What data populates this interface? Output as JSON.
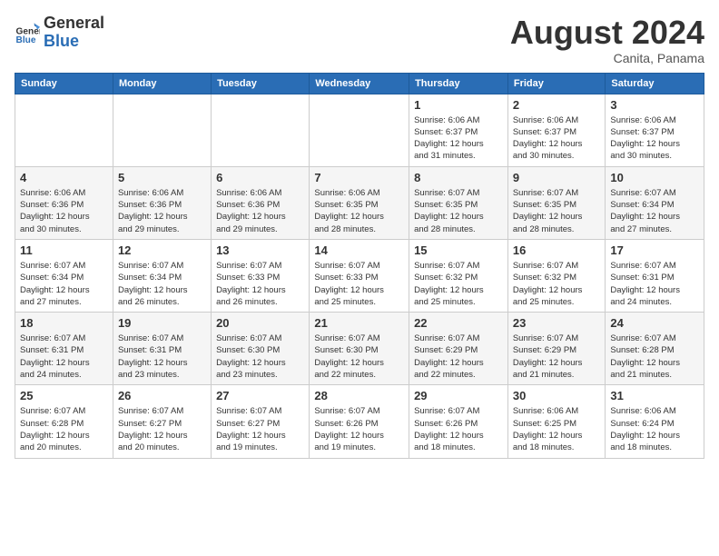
{
  "header": {
    "logo_line1": "General",
    "logo_line2": "Blue",
    "month_year": "August 2024",
    "location": "Canita, Panama"
  },
  "weekdays": [
    "Sunday",
    "Monday",
    "Tuesday",
    "Wednesday",
    "Thursday",
    "Friday",
    "Saturday"
  ],
  "weeks": [
    [
      {
        "day": "",
        "info": ""
      },
      {
        "day": "",
        "info": ""
      },
      {
        "day": "",
        "info": ""
      },
      {
        "day": "",
        "info": ""
      },
      {
        "day": "1",
        "info": "Sunrise: 6:06 AM\nSunset: 6:37 PM\nDaylight: 12 hours\nand 31 minutes."
      },
      {
        "day": "2",
        "info": "Sunrise: 6:06 AM\nSunset: 6:37 PM\nDaylight: 12 hours\nand 30 minutes."
      },
      {
        "day": "3",
        "info": "Sunrise: 6:06 AM\nSunset: 6:37 PM\nDaylight: 12 hours\nand 30 minutes."
      }
    ],
    [
      {
        "day": "4",
        "info": "Sunrise: 6:06 AM\nSunset: 6:36 PM\nDaylight: 12 hours\nand 30 minutes."
      },
      {
        "day": "5",
        "info": "Sunrise: 6:06 AM\nSunset: 6:36 PM\nDaylight: 12 hours\nand 29 minutes."
      },
      {
        "day": "6",
        "info": "Sunrise: 6:06 AM\nSunset: 6:36 PM\nDaylight: 12 hours\nand 29 minutes."
      },
      {
        "day": "7",
        "info": "Sunrise: 6:06 AM\nSunset: 6:35 PM\nDaylight: 12 hours\nand 28 minutes."
      },
      {
        "day": "8",
        "info": "Sunrise: 6:07 AM\nSunset: 6:35 PM\nDaylight: 12 hours\nand 28 minutes."
      },
      {
        "day": "9",
        "info": "Sunrise: 6:07 AM\nSunset: 6:35 PM\nDaylight: 12 hours\nand 28 minutes."
      },
      {
        "day": "10",
        "info": "Sunrise: 6:07 AM\nSunset: 6:34 PM\nDaylight: 12 hours\nand 27 minutes."
      }
    ],
    [
      {
        "day": "11",
        "info": "Sunrise: 6:07 AM\nSunset: 6:34 PM\nDaylight: 12 hours\nand 27 minutes."
      },
      {
        "day": "12",
        "info": "Sunrise: 6:07 AM\nSunset: 6:34 PM\nDaylight: 12 hours\nand 26 minutes."
      },
      {
        "day": "13",
        "info": "Sunrise: 6:07 AM\nSunset: 6:33 PM\nDaylight: 12 hours\nand 26 minutes."
      },
      {
        "day": "14",
        "info": "Sunrise: 6:07 AM\nSunset: 6:33 PM\nDaylight: 12 hours\nand 25 minutes."
      },
      {
        "day": "15",
        "info": "Sunrise: 6:07 AM\nSunset: 6:32 PM\nDaylight: 12 hours\nand 25 minutes."
      },
      {
        "day": "16",
        "info": "Sunrise: 6:07 AM\nSunset: 6:32 PM\nDaylight: 12 hours\nand 25 minutes."
      },
      {
        "day": "17",
        "info": "Sunrise: 6:07 AM\nSunset: 6:31 PM\nDaylight: 12 hours\nand 24 minutes."
      }
    ],
    [
      {
        "day": "18",
        "info": "Sunrise: 6:07 AM\nSunset: 6:31 PM\nDaylight: 12 hours\nand 24 minutes."
      },
      {
        "day": "19",
        "info": "Sunrise: 6:07 AM\nSunset: 6:31 PM\nDaylight: 12 hours\nand 23 minutes."
      },
      {
        "day": "20",
        "info": "Sunrise: 6:07 AM\nSunset: 6:30 PM\nDaylight: 12 hours\nand 23 minutes."
      },
      {
        "day": "21",
        "info": "Sunrise: 6:07 AM\nSunset: 6:30 PM\nDaylight: 12 hours\nand 22 minutes."
      },
      {
        "day": "22",
        "info": "Sunrise: 6:07 AM\nSunset: 6:29 PM\nDaylight: 12 hours\nand 22 minutes."
      },
      {
        "day": "23",
        "info": "Sunrise: 6:07 AM\nSunset: 6:29 PM\nDaylight: 12 hours\nand 21 minutes."
      },
      {
        "day": "24",
        "info": "Sunrise: 6:07 AM\nSunset: 6:28 PM\nDaylight: 12 hours\nand 21 minutes."
      }
    ],
    [
      {
        "day": "25",
        "info": "Sunrise: 6:07 AM\nSunset: 6:28 PM\nDaylight: 12 hours\nand 20 minutes."
      },
      {
        "day": "26",
        "info": "Sunrise: 6:07 AM\nSunset: 6:27 PM\nDaylight: 12 hours\nand 20 minutes."
      },
      {
        "day": "27",
        "info": "Sunrise: 6:07 AM\nSunset: 6:27 PM\nDaylight: 12 hours\nand 19 minutes."
      },
      {
        "day": "28",
        "info": "Sunrise: 6:07 AM\nSunset: 6:26 PM\nDaylight: 12 hours\nand 19 minutes."
      },
      {
        "day": "29",
        "info": "Sunrise: 6:07 AM\nSunset: 6:26 PM\nDaylight: 12 hours\nand 18 minutes."
      },
      {
        "day": "30",
        "info": "Sunrise: 6:06 AM\nSunset: 6:25 PM\nDaylight: 12 hours\nand 18 minutes."
      },
      {
        "day": "31",
        "info": "Sunrise: 6:06 AM\nSunset: 6:24 PM\nDaylight: 12 hours\nand 18 minutes."
      }
    ]
  ]
}
